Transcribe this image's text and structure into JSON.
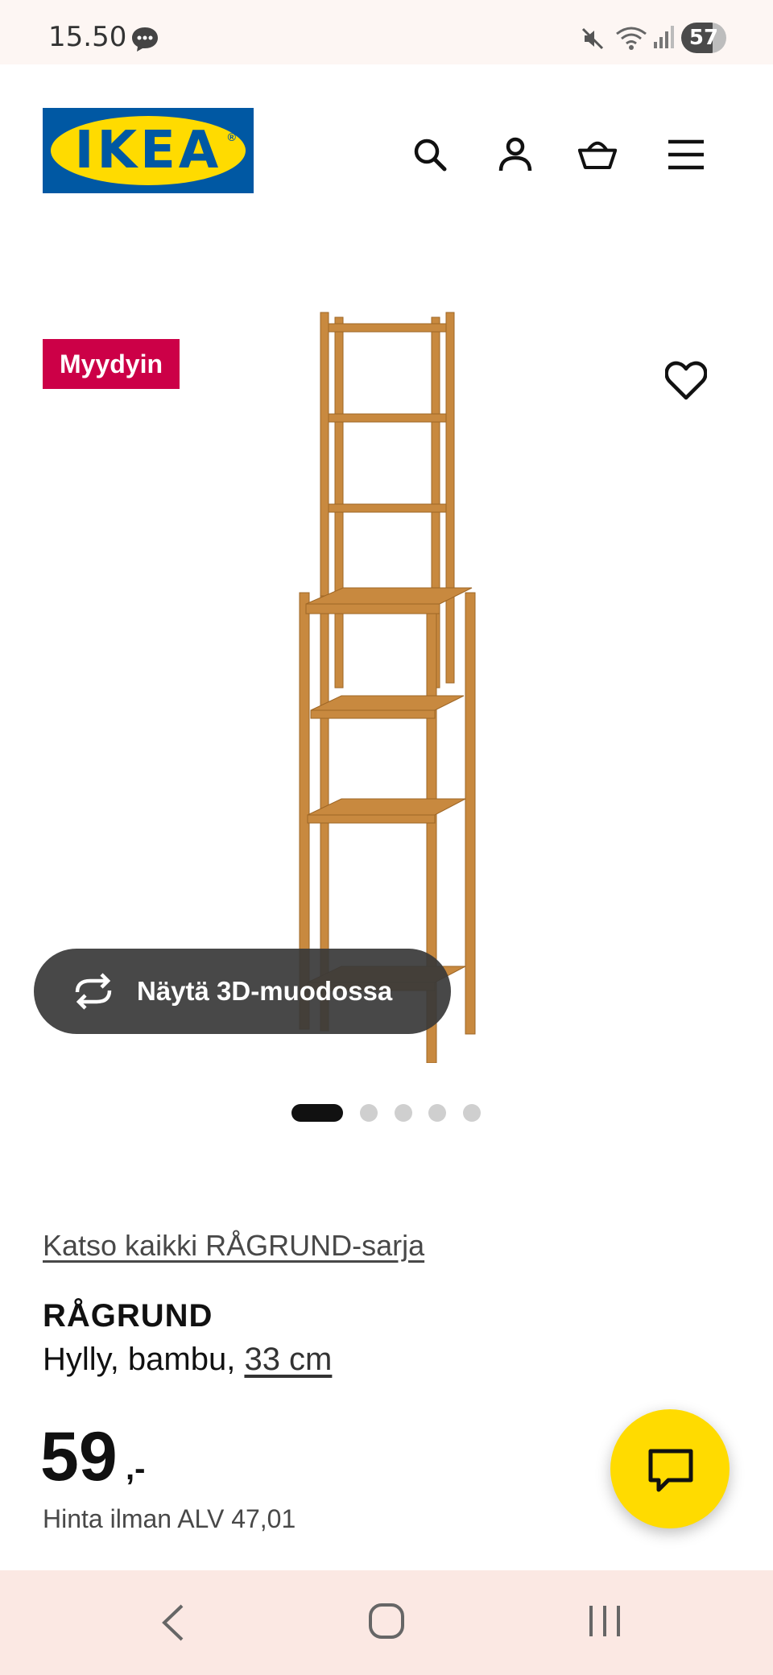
{
  "status_bar": {
    "time": "15.50",
    "battery": "57",
    "icons": [
      "chat-bubble-icon",
      "mute-icon",
      "wifi-icon",
      "signal-icon"
    ]
  },
  "header": {
    "logo_text": "IKEA",
    "logo_reg": "®",
    "icons": [
      "search-icon",
      "account-icon",
      "cart-icon",
      "menu-icon"
    ]
  },
  "cut_off_text": "··· ·· ·· ·· ·· ··  ··· ·· ·· ···",
  "product_image": {
    "badge": "Myydyin",
    "view_3d_label": "Näytä 3D-muodossa",
    "carousel": {
      "total": 5,
      "active": 1
    }
  },
  "product": {
    "series_link": "Katso kaikki RÅGRUND-sarja",
    "name": "RÅGRUND",
    "description_prefix": "Hylly, bambu, ",
    "size_link": "33 cm",
    "price_integer": "59",
    "price_suffix": ",-",
    "price_vat": "Hinta ilman ALV 47,01"
  },
  "colors": {
    "brand_blue": "#0058a3",
    "brand_yellow": "#ffdb00",
    "badge_red": "#cc0047",
    "wood": "#c8893f"
  },
  "nav_bar": {
    "icons": [
      "back-icon",
      "home-icon",
      "recent-apps-icon"
    ]
  }
}
